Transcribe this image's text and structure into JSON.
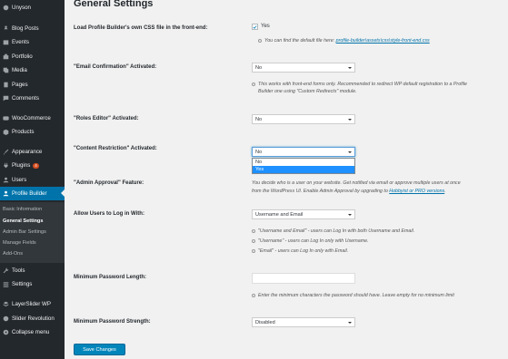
{
  "sidebar": {
    "items": [
      {
        "label": "Unyson",
        "icon": "unyson-icon"
      },
      {
        "label": "Blog Posts",
        "icon": "pushpin-icon"
      },
      {
        "label": "Events",
        "icon": "calendar-icon"
      },
      {
        "label": "Portfolio",
        "icon": "portfolio-icon"
      },
      {
        "label": "Media",
        "icon": "media-icon"
      },
      {
        "label": "Pages",
        "icon": "page-icon"
      },
      {
        "label": "Comments",
        "icon": "comment-icon"
      },
      {
        "label": "WooCommerce",
        "icon": "woocommerce-icon"
      },
      {
        "label": "Products",
        "icon": "products-icon"
      },
      {
        "label": "Appearance",
        "icon": "brush-icon"
      },
      {
        "label": "Plugins",
        "icon": "plugin-icon",
        "badge": "4"
      },
      {
        "label": "Users",
        "icon": "users-icon"
      },
      {
        "label": "Profile Builder",
        "icon": "profile-builder-icon"
      },
      {
        "label": "Tools",
        "icon": "wrench-icon"
      },
      {
        "label": "Settings",
        "icon": "settings-icon"
      },
      {
        "label": "LayerSlider WP",
        "icon": "layerslider-icon"
      },
      {
        "label": "Slider Revolution",
        "icon": "slider-revolution-icon"
      },
      {
        "label": "Collapse menu",
        "icon": "collapse-icon"
      }
    ],
    "submenu": [
      "Basic Information",
      "General Settings",
      "Admin Bar Settings",
      "Manage Fields",
      "Add-Ons"
    ]
  },
  "page": {
    "title": "General Settings",
    "load_css": {
      "label": "Load Profile Builder's own CSS file in the front-end:",
      "checkbox_label": "Yes",
      "checked": true,
      "desc_prefix": "You can find the default file here:",
      "desc_link": "profile-builder\\assets\\css\\style-front-end.css"
    },
    "email_confirmation": {
      "label": "\"Email Confirmation\" Activated:",
      "value": "No",
      "desc1": "This works with front-end forms only. Recommended to redirect WP default registration to a Profile",
      "desc2": "Builder one using \"Custom Redirects\" module."
    },
    "roles_editor": {
      "label": "\"Roles Editor\" Activated:",
      "value": "No"
    },
    "content_restriction": {
      "label": "\"Content Restriction\" Activated:",
      "value": "No",
      "options": [
        "No",
        "Yes"
      ],
      "highlighted": "Yes"
    },
    "admin_approval": {
      "label": "\"Admin Approval\" Feature:",
      "desc1": "You decide who is a user on your website. Get notified via email or approve multiple users at once",
      "desc2_prefix": "from the WordPress UI. Enable Admin Approval by upgrading to",
      "desc2_link1": "Hobbyist or PRO versions",
      "desc2_suffix": "."
    },
    "allow_login": {
      "label": "Allow Users to Log in With:",
      "value": "Username and Email",
      "bullets": [
        "\"Username and Email\" - users can Log In with both Username and Email.",
        "\"Username\" - users can Log In only with Username.",
        "\"Email\" - users can Log In only with Email."
      ]
    },
    "min_password_length": {
      "label": "Minimum Password Length:",
      "value": "",
      "desc": "Enter the minimum characters the password should have. Leave empty for no minimum limit"
    },
    "min_password_strength": {
      "label": "Minimum Password Strength:",
      "value": "Disabled"
    },
    "save_label": "Save Changes"
  },
  "colors": {
    "sidebar_bg": "#23282d",
    "active_bg": "#0073aa",
    "primary_button": "#0085ba",
    "dropdown_highlight": "#1e90ff",
    "plugin_badge": "#d54e21"
  }
}
